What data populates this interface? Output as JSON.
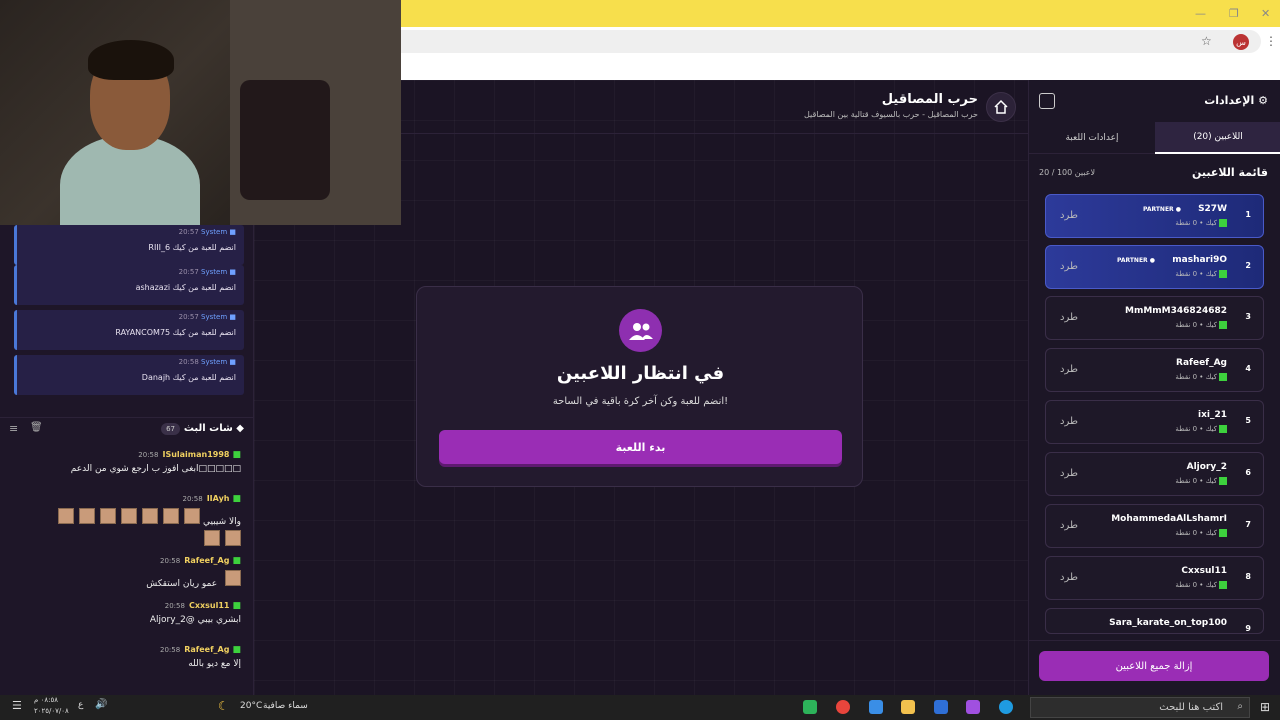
{
  "browser": {
    "profile_initial": "س"
  },
  "system_messages": [
    {
      "sender": "System",
      "time": "20:57",
      "text": "RIII_6 انضم للعبة من كيك"
    },
    {
      "sender": "System",
      "time": "20:57",
      "text": "ashazazi انضم للعبة من كيك"
    },
    {
      "sender": "System",
      "time": "20:57",
      "text": "RAYANCOM75 انضم للعبة من كيك"
    },
    {
      "sender": "System",
      "time": "20:58",
      "text": "Danajh انضم للعبة من كيك"
    }
  ],
  "chat": {
    "title": "شات البث",
    "count": "67",
    "messages": [
      {
        "user": "ISulaiman1998",
        "time": "20:58",
        "text": "ابغى افوز ب ارجع شوي من الدعم□□□□□"
      },
      {
        "user": "IIAyh",
        "time": "20:58",
        "text": "والا شيبيي"
      },
      {
        "user": "Rafeef_Ag",
        "time": "20:58",
        "text": "عمو ريان استقكش"
      },
      {
        "user": "Cxxsul11",
        "time": "20:58",
        "text": "Aljory_2@ ابشري بيبي"
      },
      {
        "user": "Rafeef_Ag",
        "time": "20:58",
        "text": "إلا مع ديو بالله"
      }
    ]
  },
  "game": {
    "title": "حرب المصاقيل",
    "subtitle": "حرب المصاقيل - حرب بالسيوف قتالية بين المصاقيل",
    "waiting_title": "في انتظار اللاعبين",
    "waiting_sub": "انضم للعبة وكن آخر كرة باقية في الساحة!",
    "start_button": "بدء اللعبة"
  },
  "settings": {
    "title": "الإعدادات",
    "tabs": {
      "players": "اللاعبين (20)",
      "game": "إعدادات اللعبة"
    },
    "list_title": "قائمة اللاعبين",
    "list_count": "20 / 100 لاعبين",
    "kick_label": "طرد",
    "remove_all": "إزالة جميع اللاعبين",
    "players": [
      {
        "num": "1",
        "name": "S27W",
        "meta": "كيك • 0 نقطة",
        "partner": "PARTNER"
      },
      {
        "num": "2",
        "name": "mashari9O",
        "meta": "كيك • 0 نقطة",
        "partner": "PARTNER"
      },
      {
        "num": "3",
        "name": "MmMmM346824682",
        "meta": "كيك • 0 نقطة"
      },
      {
        "num": "4",
        "name": "Rafeef_Ag",
        "meta": "كيك • 0 نقطة"
      },
      {
        "num": "5",
        "name": "ixi_21",
        "meta": "كيك • 0 نقطة"
      },
      {
        "num": "6",
        "name": "Aljory_2",
        "meta": "كيك • 0 نقطة"
      },
      {
        "num": "7",
        "name": "MohammedaAlLshamrI",
        "meta": "كيك • 0 نقطة"
      },
      {
        "num": "8",
        "name": "Cxxsul11",
        "meta": "كيك • 0 نقطة"
      },
      {
        "num": "9",
        "name": "Sara_karate_on_top100",
        "meta": ""
      }
    ]
  },
  "taskbar": {
    "search_placeholder": "اكتب هنا للبحث",
    "weather": "سماء صافية",
    "temp": "20°C",
    "time": "٠٨:٥٨ م",
    "date": "٢٠٢٥/٠٧/٠٨",
    "lang": "ع"
  }
}
